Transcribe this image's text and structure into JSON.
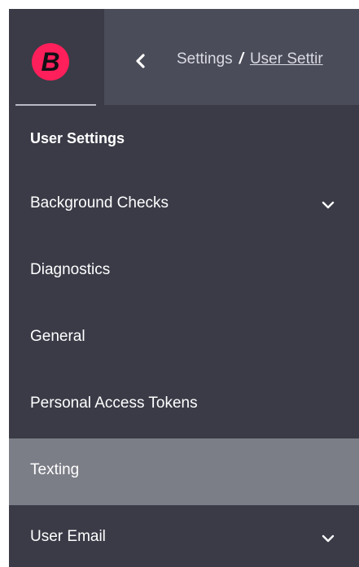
{
  "header": {
    "logo_letter": "B",
    "breadcrumb": {
      "root": "Settings",
      "separator": "/",
      "current": "User Settir"
    }
  },
  "sidebar": {
    "section_title": "User Settings",
    "items": [
      {
        "label": "Background Checks",
        "expandable": true,
        "active": false
      },
      {
        "label": "Diagnostics",
        "expandable": false,
        "active": false
      },
      {
        "label": "General",
        "expandable": false,
        "active": false
      },
      {
        "label": "Personal Access Tokens",
        "expandable": false,
        "active": false
      },
      {
        "label": "Texting",
        "expandable": false,
        "active": true
      },
      {
        "label": "User Email",
        "expandable": true,
        "active": false
      }
    ]
  },
  "colors": {
    "brand_accent": "#ff1f5a",
    "sidebar_bg": "#3a3b47",
    "topbar_bg": "#4a4c59",
    "active_item_bg": "#7c7e87"
  },
  "icons": {
    "back": "chevron-left-icon",
    "expand": "chevron-down-icon"
  }
}
